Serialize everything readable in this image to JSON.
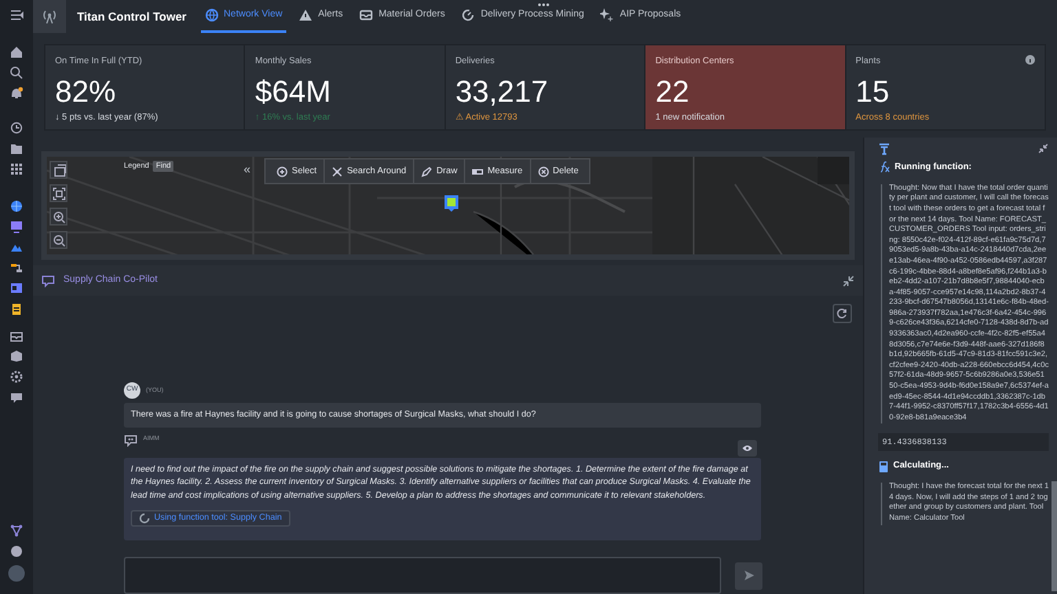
{
  "app": {
    "title": "Titan Control Tower"
  },
  "nav_tabs": [
    {
      "label": "Network View",
      "kind": "globe",
      "selected": true
    },
    {
      "label": "Alerts",
      "kind": "warning",
      "selected": false
    },
    {
      "label": "Material Orders",
      "kind": "inbox",
      "selected": false
    },
    {
      "label": "Delivery Process Mining",
      "kind": "cycle",
      "selected": false
    },
    {
      "label": "AIP Proposals",
      "kind": "sparkle",
      "selected": false
    }
  ],
  "kpis": [
    {
      "label": "On Time In Full (YTD)",
      "value": "82%",
      "note": "↓ 5 pts vs. last year (87%)",
      "kind": "neutral",
      "alert": false
    },
    {
      "label": "Monthly Sales",
      "value": "$64M",
      "note": "↑ 16% vs. last year",
      "kind": "positive",
      "alert": false
    },
    {
      "label": "Deliveries",
      "value": "33,217",
      "note": "⚠ Active 12793",
      "kind": "warning",
      "alert": false
    },
    {
      "label": "Distribution Centers",
      "value": "22",
      "note": "1 new notification",
      "kind": "neutral",
      "alert": true
    },
    {
      "label": "Plants",
      "value": "15",
      "note": "Across 8 countries",
      "kind": "warning",
      "alert": false
    }
  ],
  "map": {
    "legend_button": "Legend",
    "find_button": "Find",
    "collapse": "«",
    "tools": [
      {
        "label": "Select",
        "kind": "select"
      },
      {
        "label": "Search Around",
        "kind": "search-around"
      },
      {
        "label": "Draw",
        "kind": "draw"
      },
      {
        "label": "Measure",
        "kind": "measure"
      },
      {
        "label": "Delete",
        "kind": "delete"
      }
    ]
  },
  "copilot": {
    "title": "Supply Chain Co-Pilot",
    "messages": [
      {
        "kind": "user",
        "initials": "CW",
        "author": "(YOU)",
        "text": "There was a fire at Haynes facility and it is going to cause shortages of Surgical Masks, what should I do?"
      },
      {
        "kind": "assistant",
        "author": "AIMM",
        "text": "I need to find out the impact of the fire on the supply chain and suggest possible solutions to mitigate the shortages. 1. Determine the extent of the fire damage at the Haynes facility. 2. Assess the current inventory of Surgical Masks. 3. Identify alternative suppliers or facilities that can produce Surgical Masks. 4. Evaluate the lead time and cost implications of using alternative suppliers. 5. Develop a plan to address the shortages and communicate it to relevant stakeholders.",
        "tool_status": "Using function tool: Supply Chain"
      }
    ]
  },
  "steps": [
    {
      "kind": "function",
      "title": "Running function:",
      "text": "Thought: Now that I have the total order quantity per plant and customer, I will call the forecast tool with these orders to get a forecast total for the next 14 days. Tool Name: FORECAST_CUSTOMER_ORDERS Tool input: orders_string: 8550c42e-f024-412f-89cf-e61fa9c75d7d,79053ed5-9a8b-43ba-a14c-2418440d7cda,2eee13ab-46ea-4f90-a452-0586edb44597,a3f287c6-199c-4bbe-88d4-a8bef8e5af96,f244b1a3-beb2-4dd2-a107-21b7d8b8e5f7,98844040-ecba-4f85-9057-cce957e14c98,114a2bd2-8b37-4233-9bcf-d67547b8056d,13141e6c-f84b-48ed-986a-273937f782aa,1e476c3f-6a42-454c-9969-c626ce43f36a,6214cfe0-7128-438d-8d7b-ad9336363ac0,4d2ea960-ccfe-4f2c-82f5-ef55a48d3056,c7e74e6e-f3d9-448f-aae6-327d186f8b1d,92b665fb-61d5-47c9-81d3-81fcc591c3e2,cf2cfee9-2420-40db-a228-660ebcc6d454,4c0c57f2-61da-48d9-9657-5c6b9286a0e3,536e5150-c5ea-4953-9d4b-f6d0e158a9e7,6c5374ef-aed9-45ec-8544-4d1e94ccddb1,3362387c-1db7-44f1-9952-c8370ff57f17,1782c3b4-6556-4d10-92e8-b81a9eace3b4"
    },
    {
      "kind": "result",
      "text": "91.4336838133"
    },
    {
      "kind": "calc",
      "title": "Calculating...",
      "text": "Thought: I have the forecast total for the next 14 days. Now, I will add the steps of 1 and 2 together and group by customers and plant. Tool Name: Calculator Tool"
    }
  ]
}
